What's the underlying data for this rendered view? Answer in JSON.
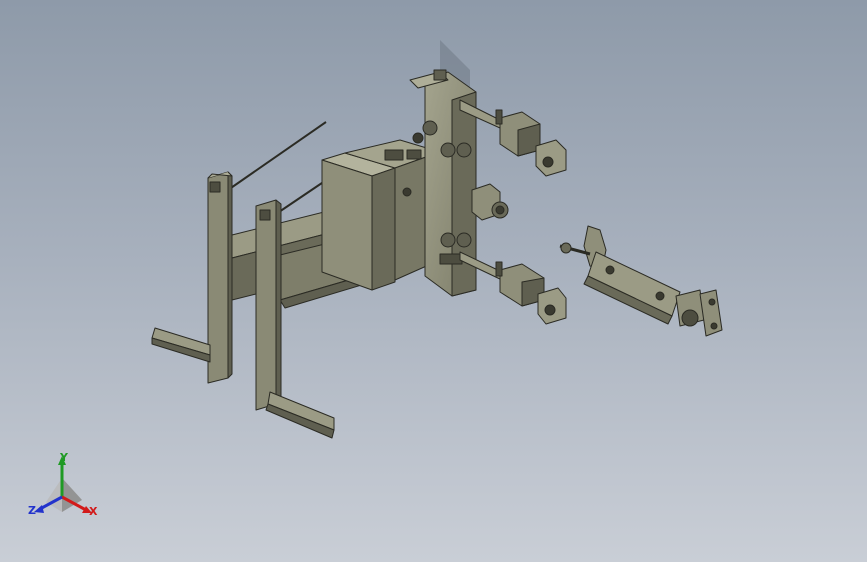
{
  "triad": {
    "x_label": "X",
    "y_label": "Y",
    "z_label": "Z"
  },
  "colors": {
    "part_face": "#8f8f7a",
    "part_dark": "#5f5f50",
    "part_light": "#aeae98",
    "edge": "#2b2b24",
    "x_axis": "#d21a1a",
    "y_axis": "#1f9a24",
    "z_axis": "#2233cc"
  },
  "icons": {
    "orientation_triad": "triad-icon"
  }
}
